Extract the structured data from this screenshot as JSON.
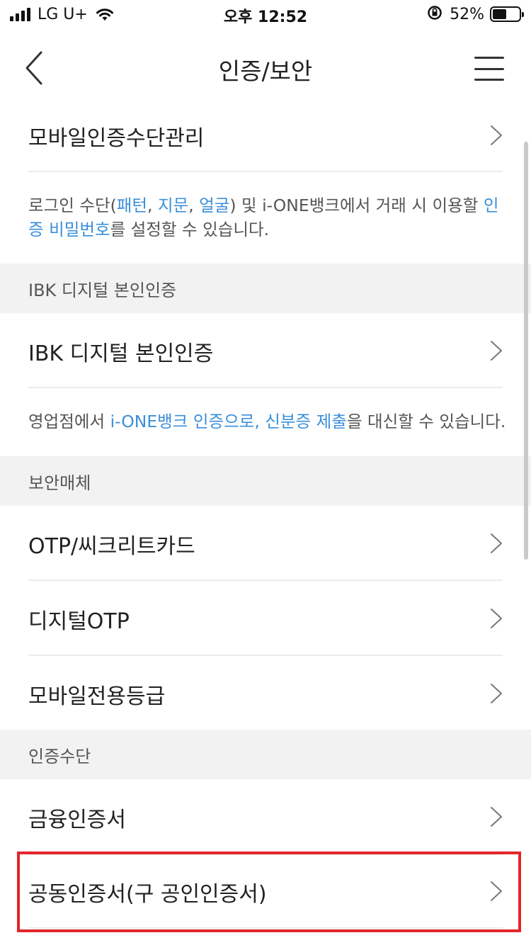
{
  "status_bar": {
    "carrier": "LG U+",
    "time": "오후 12:52",
    "battery_percent": "52%",
    "battery_level": 0.52
  },
  "header": {
    "title": "인증/보안",
    "back_icon": "chevron-left-icon",
    "menu_icon": "hamburger-menu-icon"
  },
  "groups": {
    "mobile": {
      "item_label": "모바일인증수단관리",
      "desc": {
        "t1": "로그인 수단(",
        "h1": "패턴",
        "t2": ", ",
        "h2": "지문",
        "t3": ", ",
        "h3": "얼굴",
        "t4": ") 및 i-ONE뱅크에서 거래 시 이용할 ",
        "h4": "인증 비밀번호",
        "t5": "를 설정할 수 있습니다."
      }
    },
    "ibk": {
      "section_label": "IBK 디지털 본인인증",
      "item_label": "IBK 디지털 본인인증",
      "desc": {
        "t1": "영업점에서 ",
        "h1": "i-ONE뱅크 인증으로, 신분증 제출",
        "t2": "을 대신할 수 있습니다."
      }
    },
    "security": {
      "section_label": "보안매체",
      "items": [
        "OTP/씨크리트카드",
        "디지털OTP",
        "모바일전용등급"
      ]
    },
    "auth": {
      "section_label": "인증수단",
      "items": [
        "금융인증서",
        "공동인증서(구 공인인증서)"
      ]
    }
  },
  "colors": {
    "highlight_text": "#3a8fd9",
    "annotation_box": "#e3262b",
    "section_bg": "#f2f2f2"
  }
}
